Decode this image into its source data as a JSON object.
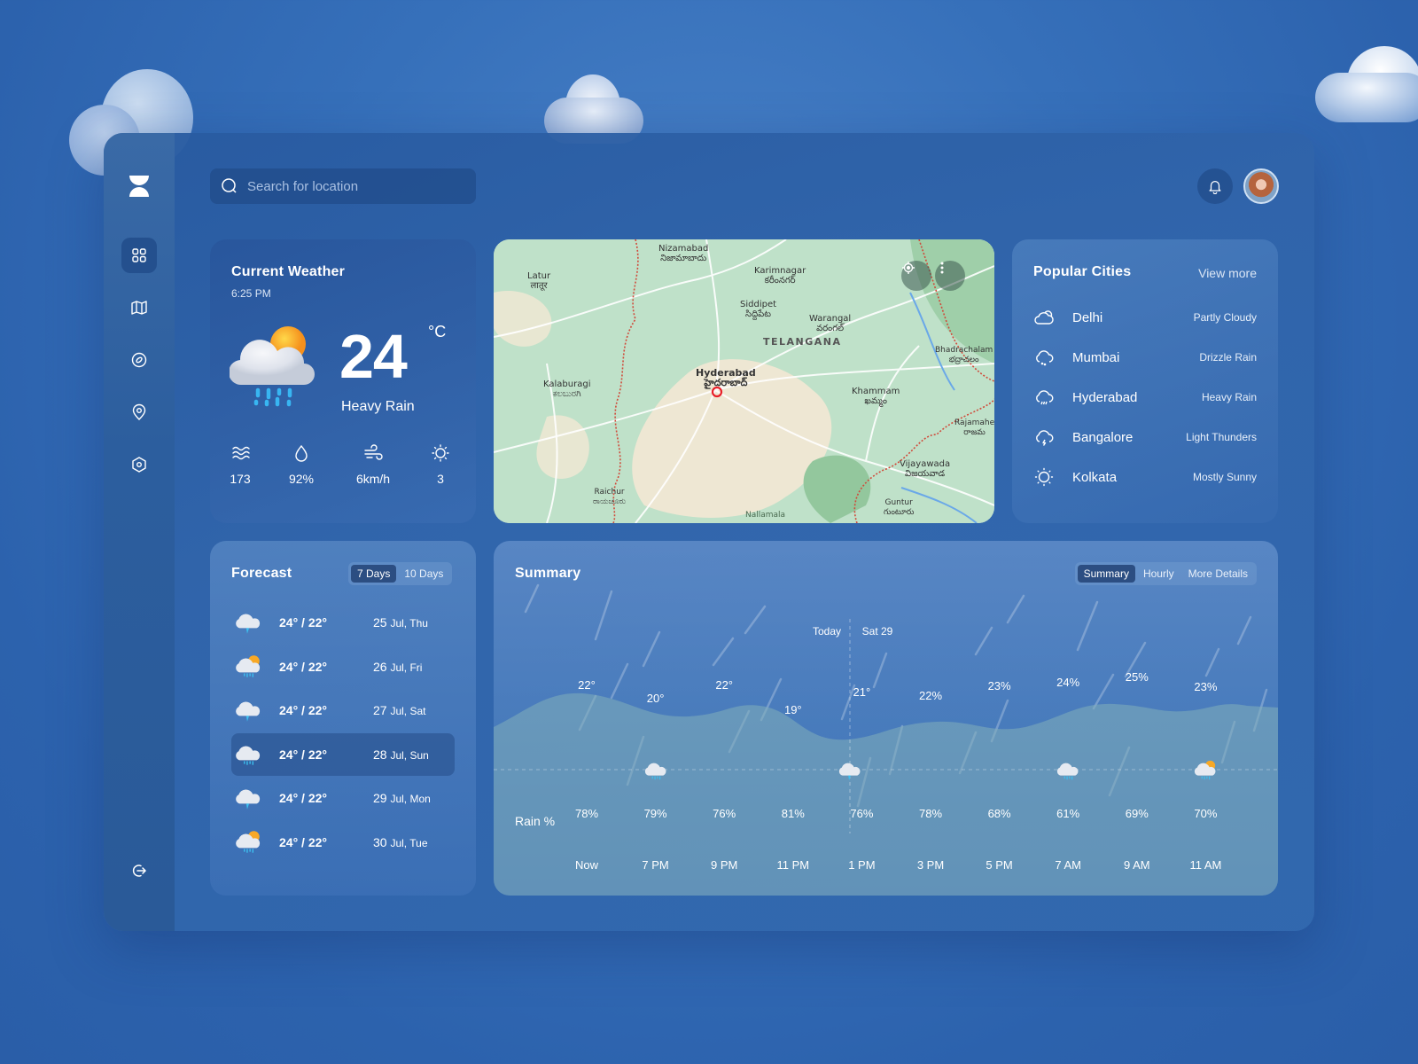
{
  "search": {
    "placeholder": "Search for location"
  },
  "sidebar": {
    "items": [
      {
        "name": "dashboard",
        "icon": "grid-icon",
        "active": true
      },
      {
        "name": "map",
        "icon": "map-icon",
        "active": false
      },
      {
        "name": "explore",
        "icon": "compass-icon",
        "active": false
      },
      {
        "name": "location",
        "icon": "location-pin-icon",
        "active": false
      },
      {
        "name": "settings",
        "icon": "hexagon-settings-icon",
        "active": false
      }
    ],
    "logout_icon": "logout-icon"
  },
  "current_weather": {
    "title": "Current Weather",
    "time": "6:25 PM",
    "temperature": "24",
    "unit": "°C",
    "condition": "Heavy Rain",
    "icon": "heavy-rain-sun-icon",
    "stats": [
      {
        "icon": "waves-icon",
        "value": "173"
      },
      {
        "icon": "humidity-drop-icon",
        "value": "92%"
      },
      {
        "icon": "wind-icon",
        "value": "6km/h"
      },
      {
        "icon": "uv-sun-icon",
        "value": "3"
      }
    ]
  },
  "map": {
    "labels": [
      {
        "name": "Nizamabad",
        "local": "నిజామాబాదు"
      },
      {
        "name": "Latur",
        "local": "लातूर"
      },
      {
        "name": "Karimnagar",
        "local": "కరీంనగర్"
      },
      {
        "name": "Siddipet",
        "local": "సిద్దిపేట"
      },
      {
        "name": "Warangal",
        "local": "వరంగల్"
      },
      {
        "name": "TELANGANA",
        "local": ""
      },
      {
        "name": "Bhadrachalam",
        "local": "భద్రాచలం"
      },
      {
        "name": "Hyderabad",
        "local": "హైదరాబాద్"
      },
      {
        "name": "Kalaburagi",
        "local": "ಕಲಬುರಗಿ"
      },
      {
        "name": "Khammam",
        "local": "ఖమ్మం"
      },
      {
        "name": "Rajamahe",
        "local": "రాజమ"
      },
      {
        "name": "Vijayawada",
        "local": "విజయవాడ"
      },
      {
        "name": "Raichur",
        "local": "ರಾಯಚೂರು"
      },
      {
        "name": "Guntur",
        "local": "గుంటూరు"
      },
      {
        "name": "Nallamala",
        "local": ""
      }
    ],
    "buttons": [
      "locate-icon",
      "more-vertical-icon"
    ]
  },
  "popular_cities": {
    "title": "Popular Cities",
    "view_more": "View more",
    "items": [
      {
        "city": "Delhi",
        "condition": "Partly Cloudy",
        "icon": "partly-cloudy-icon"
      },
      {
        "city": "Mumbai",
        "condition": "Drizzle Rain",
        "icon": "drizzle-icon"
      },
      {
        "city": "Hyderabad",
        "condition": "Heavy Rain",
        "icon": "heavy-rain-icon"
      },
      {
        "city": "Bangalore",
        "condition": "Light Thunders",
        "icon": "thunder-icon"
      },
      {
        "city": "Kolkata",
        "condition": "Mostly Sunny",
        "icon": "sun-icon"
      }
    ]
  },
  "forecast": {
    "title": "Forecast",
    "tabs": [
      {
        "label": "7 Days",
        "active": true
      },
      {
        "label": "10 Days",
        "active": false
      }
    ],
    "rows": [
      {
        "temps": "24° / 22°",
        "date_num": "25",
        "date_rest": "Jul, Thu",
        "icon": "thunder-cloud-icon",
        "selected": false
      },
      {
        "temps": "24° / 22°",
        "date_num": "26",
        "date_rest": "Jul, Fri",
        "icon": "sun-rain-cloud-icon",
        "selected": false
      },
      {
        "temps": "24° / 22°",
        "date_num": "27",
        "date_rest": "Jul, Sat",
        "icon": "storm-cloud-icon",
        "selected": false
      },
      {
        "temps": "24° / 22°",
        "date_num": "28",
        "date_rest": "Jul, Sun",
        "icon": "rain-cloud-icon",
        "selected": true
      },
      {
        "temps": "24° / 22°",
        "date_num": "29",
        "date_rest": "Jul, Mon",
        "icon": "thunder-cloud-icon",
        "selected": false
      },
      {
        "temps": "24° / 22°",
        "date_num": "30",
        "date_rest": "Jul, Tue",
        "icon": "sun-rain-cloud-icon",
        "selected": false
      }
    ]
  },
  "summary": {
    "title": "Summary",
    "tabs": [
      {
        "label": "Summary",
        "active": true
      },
      {
        "label": "Hourly",
        "active": false
      },
      {
        "label": "More Details",
        "active": false
      }
    ],
    "today_label": "Today",
    "next_day_label": "Sat 29",
    "rain_label": "Rain %",
    "columns": [
      {
        "time": "Now",
        "top": "22°",
        "rain": "78%",
        "icon": ""
      },
      {
        "time": "7 PM",
        "top": "20°",
        "rain": "79%",
        "icon": "rain-cloud-icon"
      },
      {
        "time": "9 PM",
        "top": "22°",
        "rain": "76%",
        "icon": ""
      },
      {
        "time": "11 PM",
        "top": "19°",
        "rain": "81%",
        "icon": ""
      },
      {
        "time": "1 PM",
        "top": "21°",
        "rain": "76%",
        "icon": "thunder-cloud-icon"
      },
      {
        "time": "3 PM",
        "top": "22%",
        "rain": "78%",
        "icon": ""
      },
      {
        "time": "5 PM",
        "top": "23%",
        "rain": "68%",
        "icon": ""
      },
      {
        "time": "7 AM",
        "top": "24%",
        "rain": "61%",
        "icon": "rain-cloud-icon"
      },
      {
        "time": "9 AM",
        "top": "25%",
        "rain": "69%",
        "icon": ""
      },
      {
        "time": "11 AM",
        "top": "23%",
        "rain": "70%",
        "icon": "sun-rain-cloud-icon"
      }
    ]
  }
}
